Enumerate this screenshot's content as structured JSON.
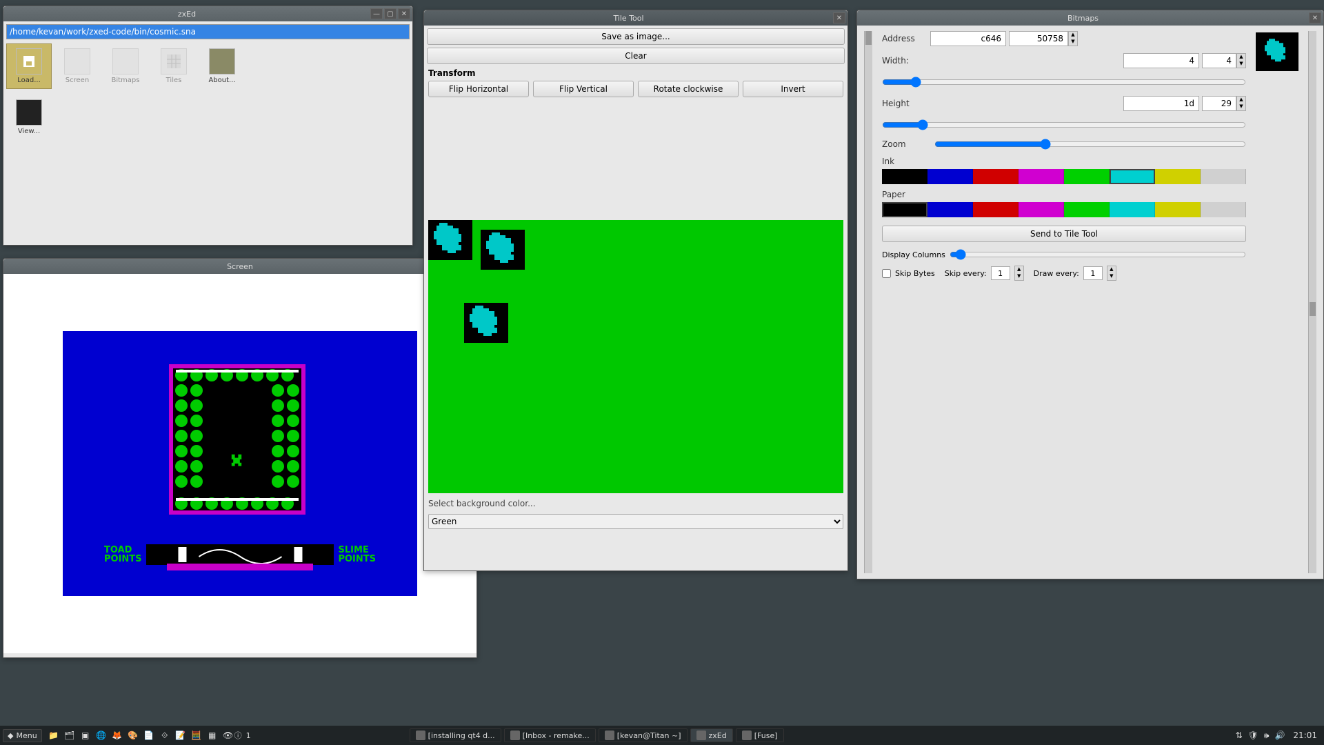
{
  "zxed": {
    "title": "zxEd",
    "path_value": "/home/kevan/work/zxed-code/bin/cosmic.sna",
    "icons": [
      {
        "label": "Load...",
        "name": "load-icon",
        "selected": true
      },
      {
        "label": "Screen",
        "name": "screen-icon",
        "disabled": true
      },
      {
        "label": "Bitmaps",
        "name": "bitmaps-icon",
        "disabled": true
      },
      {
        "label": "Tiles",
        "name": "tiles-icon",
        "disabled": true
      },
      {
        "label": "About...",
        "name": "about-icon"
      },
      {
        "label": "View...",
        "name": "view-icon"
      }
    ]
  },
  "screen": {
    "title": "Screen",
    "hud_left": "TOAD\nPOINTS",
    "hud_right": "SLIME\nPOINTS"
  },
  "tiletool": {
    "title": "Tile Tool",
    "save_btn": "Save as image...",
    "clear_btn": "Clear",
    "transform_label": "Transform",
    "flip_h": "Flip Horizontal",
    "flip_v": "Flip Vertical",
    "rotate": "Rotate clockwise",
    "invert": "Invert",
    "bg_label": "Select background color...",
    "bg_value": "Green"
  },
  "bitmaps": {
    "title": "Bitmaps",
    "address_label": "Address",
    "address_hex": "c646",
    "address_dec": "50758",
    "width_label": "Width:",
    "width_hex": "4",
    "width_dec": "4",
    "height_label": "Height",
    "height_hex": "1d",
    "height_dec": "29",
    "zoom_label": "Zoom",
    "ink_label": "Ink",
    "paper_label": "Paper",
    "send_btn": "Send to Tile Tool",
    "display_cols_label": "Display Columns",
    "skip_bytes_label": "Skip Bytes",
    "skip_every_label": "Skip every:",
    "skip_every_value": "1",
    "draw_every_label": "Draw every:",
    "draw_every_value": "1",
    "palette": [
      "#000000",
      "#0000d0",
      "#d00000",
      "#d000d0",
      "#00d000",
      "#00d0d0",
      "#d0d000",
      "#d0d0d0"
    ],
    "ink_selected": 5,
    "paper_selected": 0
  },
  "taskbar": {
    "menu": "Menu",
    "workspace_badge": "1",
    "tasks": [
      {
        "label": "[installing qt4 d...",
        "active": false
      },
      {
        "label": "[Inbox - remake...",
        "active": false
      },
      {
        "label": "[kevan@Titan ~]",
        "active": false
      },
      {
        "label": "zxEd",
        "active": true
      },
      {
        "label": "[Fuse]",
        "active": false
      }
    ],
    "clock": "21:01"
  }
}
